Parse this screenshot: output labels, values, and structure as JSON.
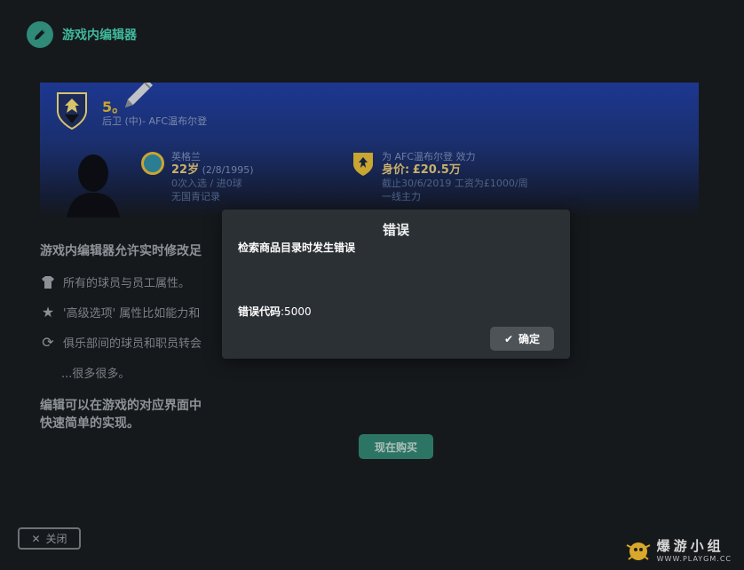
{
  "header": {
    "title": "游戏内编辑器"
  },
  "player_card": {
    "name": "5。",
    "position": "后卫 (中)- AFC温布尔登",
    "nation": "英格兰",
    "age": "22岁",
    "dob": "(2/8/1995)",
    "caps": "0次入选 / 进0球",
    "intl_record": "无国青记录",
    "club_line": "为 AFC温布尔登 效力",
    "value_label": "身价:",
    "value": "£20.5万",
    "contract": "截止30/6/2019 工资为£1000/周",
    "extra": "一线主力"
  },
  "content": {
    "intro": "游戏内编辑器允许实时修改足",
    "features": [
      {
        "icon": "shirt-icon",
        "text": "所有的球员与员工属性。"
      },
      {
        "icon": "star-icon",
        "text": "'高级选项' 属性比如能力和"
      },
      {
        "icon": "refresh-icon",
        "text": "俱乐部间的球员和职员转会"
      },
      {
        "icon": "",
        "text": "...很多很多。"
      }
    ],
    "outro": "编辑可以在游戏的对应界面中快速简单的实现。"
  },
  "buttons": {
    "buy_now": "现在购买",
    "close": "关闭"
  },
  "dialog": {
    "title": "错误",
    "message": "检索商品目录时发生错误",
    "code_label": "错误代码",
    "code_value": ":5000",
    "ok": "确定"
  },
  "watermark": {
    "name": "爆游小组",
    "url": "WWW.PLAYGM.CC"
  },
  "colors": {
    "accent": "#3fb89c",
    "banner": "#1d3790",
    "dialog_bg": "#2b3035",
    "gold": "#c8a52a"
  }
}
